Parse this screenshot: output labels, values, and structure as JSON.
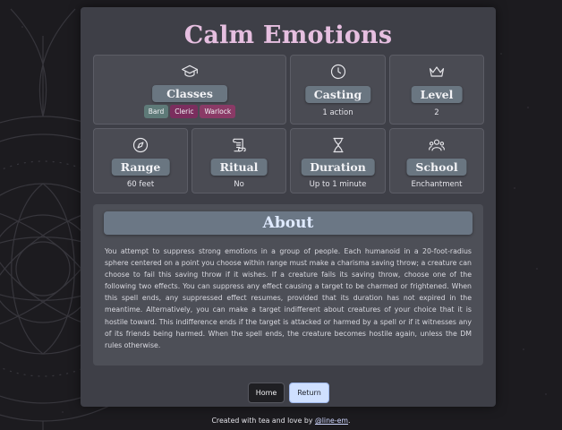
{
  "spell": {
    "title": "Calm Emotions",
    "classes": {
      "label": "Classes",
      "tags": [
        {
          "name": "Bard",
          "color": "#5e7a78"
        },
        {
          "name": "Cleric",
          "color": "#7b2e5e"
        },
        {
          "name": "Warlock",
          "color": "#8a3a66"
        }
      ]
    },
    "casting": {
      "label": "Casting",
      "value": "1 action"
    },
    "level": {
      "label": "Level",
      "value": "2"
    },
    "range": {
      "label": "Range",
      "value": "60 feet"
    },
    "ritual": {
      "label": "Ritual",
      "value": "No"
    },
    "duration": {
      "label": "Duration",
      "value": "Up to 1 minute"
    },
    "school": {
      "label": "School",
      "value": "Enchantment"
    }
  },
  "icons": {
    "classes": "graduation-cap-icon",
    "casting": "clock-icon",
    "level": "crown-icon",
    "range": "compass-icon",
    "ritual": "scroll-icon",
    "duration": "hourglass-icon",
    "school": "users-icon"
  },
  "about": {
    "heading": "About",
    "text": "You attempt to suppress strong emotions in a group of people. Each humanoid in a 20-foot-radius sphere centered on a point you choose within range must make a charisma saving throw; a creature can choose to fail this saving throw if it wishes. If a creature fails its saving throw, choose one of the following two effects. You can suppress any effect causing a target to be charmed or frightened. When this spell ends, any suppressed effect resumes, provided that its duration has not expired in the meantime. Alternatively, you can make a target indifferent about creatures of your choice that it is hostile toward. This indifference ends if the target is attacked or harmed by a spell or if it witnesses any of its friends being harmed. When the spell ends, the creature becomes hostile again, unless the DM rules otherwise."
  },
  "buttons": {
    "home": "Home",
    "return": "Return"
  },
  "footer": {
    "text": "Created with tea and love by ",
    "link": "@line-em",
    "suffix": "."
  },
  "colors": {
    "title": "#e6bfe0",
    "card": "#3e3f47",
    "pill": "#6a7681",
    "return_button": "#cfe0ff"
  }
}
